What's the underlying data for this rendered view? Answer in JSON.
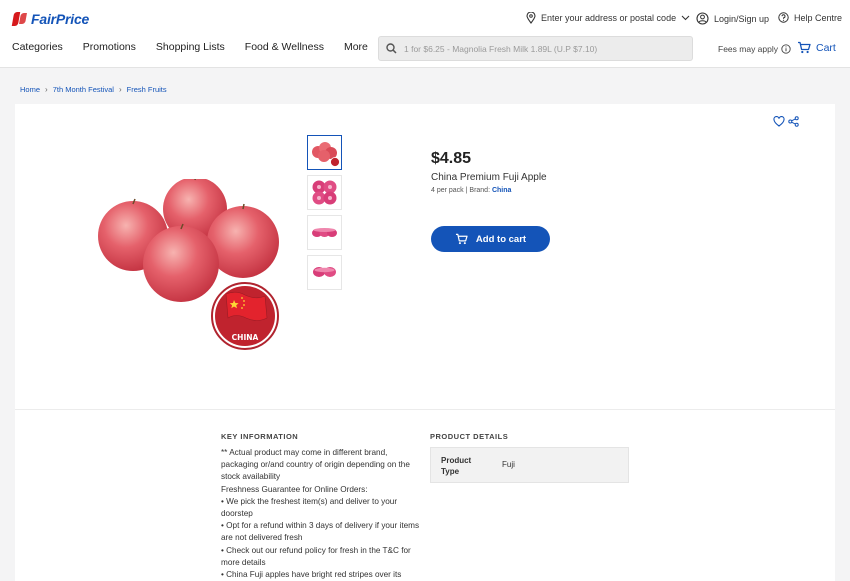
{
  "brand": {
    "name": "FairPrice"
  },
  "header": {
    "address_label": "Enter your address or postal code",
    "login_label": "Login/Sign up",
    "help_label": "Help Centre"
  },
  "nav": {
    "items": [
      "Categories",
      "Promotions",
      "Shopping Lists",
      "Food & Wellness",
      "More"
    ]
  },
  "search": {
    "placeholder": "1 for $6.25 - Magnolia Fresh Milk 1.89L (U.P $7.10)"
  },
  "fees_label": "Fees may apply",
  "cart_label": "Cart",
  "breadcrumb": [
    "Home",
    "7th Month Festival",
    "Fresh Fruits"
  ],
  "product": {
    "price": "$4.85",
    "name": "China Premium Fuji Apple",
    "pack": "4 per pack | Brand: ",
    "brand": "China",
    "add_to_cart_label": "Add to cart",
    "origin_badge_text": "CHINA"
  },
  "key_information": {
    "title": "KEY INFORMATION",
    "lines": [
      "** Actual product may come in different brand, packaging or/and country of origin depending on the stock availability",
      "Freshness Guarantee for Online Orders:",
      "• We pick the freshest item(s) and deliver to your doorstep",
      "• Opt for a refund within 3 days of delivery if your items are not delivered fresh",
      "• Check out our refund policy for fresh in the T&C for more details",
      "• China Fuji apples have bright red stripes over its"
    ]
  },
  "product_details": {
    "title": "PRODUCT DETAILS",
    "key": "Product Type",
    "value": "Fuji"
  },
  "colors": {
    "brand_blue": "#1454b8",
    "brand_red": "#d6191c",
    "apple_red": "#e04b57"
  }
}
